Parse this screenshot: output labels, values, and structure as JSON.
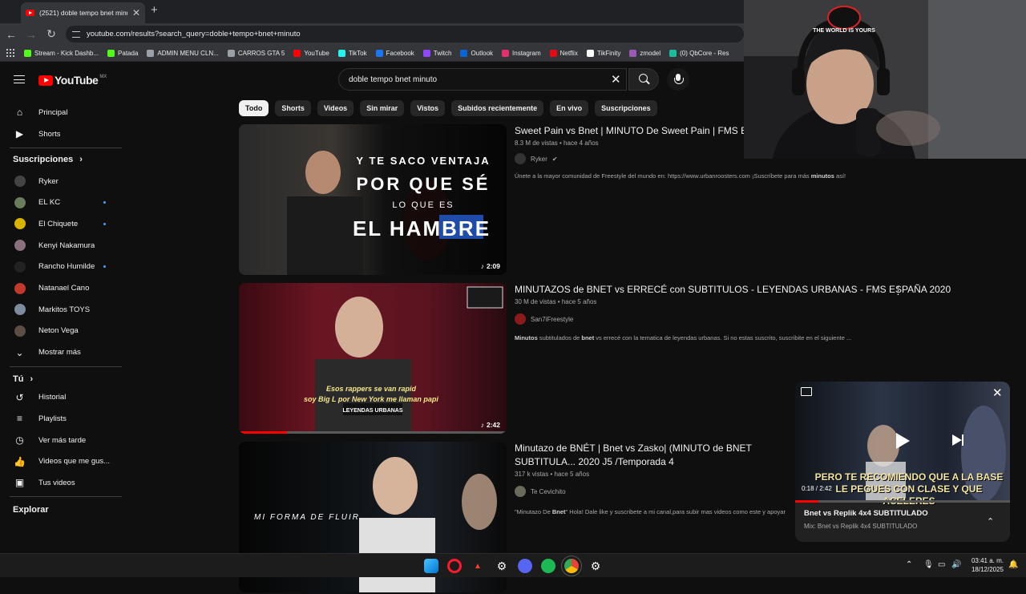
{
  "browser": {
    "tab_title": "(2521) doble tempo bnet minuto - YouTube",
    "url": "youtube.com/results?search_query=doble+tempo+bnet+minuto",
    "bookmarks": [
      {
        "label": "Stream - Kick Dashb...",
        "color": "#53fc18"
      },
      {
        "label": "Patada",
        "color": "#53fc18"
      },
      {
        "label": "ADMIN MENU CLN...",
        "color": "#9aa0a6"
      },
      {
        "label": "CARROS GTA 5",
        "color": "#9aa0a6"
      },
      {
        "label": "YouTube",
        "color": "#ff0000"
      },
      {
        "label": "TikTok",
        "color": "#25f4ee"
      },
      {
        "label": "Facebook",
        "color": "#1877f2"
      },
      {
        "label": "Twitch",
        "color": "#9146ff"
      },
      {
        "label": "Outlook",
        "color": "#0a64d6"
      },
      {
        "label": "Instagram",
        "color": "#e1306c"
      },
      {
        "label": "Netflix",
        "color": "#e50914"
      },
      {
        "label": "TikFinity",
        "color": "#ffffff"
      },
      {
        "label": "zmodel",
        "color": "#9b59b6"
      },
      {
        "label": "(0) QbCore - Res",
        "color": "#1abc9c"
      }
    ]
  },
  "youtube": {
    "logo_text": "YouTube",
    "country_code": "MX",
    "search_value": "doble tempo bnet minuto",
    "sidebar": {
      "main": [
        {
          "label": "Principal",
          "icon": "home-icon"
        },
        {
          "label": "Shorts",
          "icon": "shorts-icon"
        }
      ],
      "subs_heading": "Suscripciones",
      "subscriptions": [
        {
          "label": "Ryker",
          "color": "#444",
          "dot": false
        },
        {
          "label": "EL KC",
          "color": "#6a7d5a",
          "dot": true
        },
        {
          "label": "El Chiquete",
          "color": "#d9b300",
          "dot": true
        },
        {
          "label": "Kenyi Nakamura",
          "color": "#8a6f7e",
          "dot": false
        },
        {
          "label": "Rancho Humilde",
          "color": "#222",
          "dot": true
        },
        {
          "label": "Natanael Cano",
          "color": "#c0392b",
          "dot": false
        },
        {
          "label": "Markitos TOYS",
          "color": "#7f8c9d",
          "dot": false
        },
        {
          "label": "Neton Vega",
          "color": "#5d4e45",
          "dot": false
        }
      ],
      "show_more": "Mostrar más",
      "you_heading": "Tú",
      "you_items": [
        {
          "label": "Historial",
          "icon": "history-icon"
        },
        {
          "label": "Playlists",
          "icon": "playlist-icon"
        },
        {
          "label": "Ver más tarde",
          "icon": "clock-icon"
        },
        {
          "label": "Videos que me gus...",
          "icon": "thumbs-up-icon"
        },
        {
          "label": "Tus videos",
          "icon": "video-icon"
        }
      ],
      "explore_heading": "Explorar"
    },
    "chips": [
      "Todo",
      "Shorts",
      "Videos",
      "Sin mirar",
      "Vistos",
      "Subidos recientemente",
      "En vivo",
      "Suscripciones"
    ],
    "videos": [
      {
        "title": "Sweet Pain vs Bnet | MINUTO De Sweet Pain | FMS Es... Recuperativa | Ryker",
        "meta": "8.3 M de vistas • hace 4 años",
        "channel": "Ryker",
        "desc_pre": "Únete a la mayor comunidad de Freestyle del mundo en: https://www.urbanroosters.com ¡Suscríbete para más ",
        "desc_bold": "minutos",
        "desc_post": " así!",
        "duration": "2:09",
        "thumb_lines": [
          "Y TE SACO VENTAJA",
          "POR QUE SÉ",
          "LO QUE ES",
          "EL HAMBRE"
        ],
        "progress": 0
      },
      {
        "title": "MINUTAZOS de BNET vs ERRECÉ con SUBTITULOS - LEYENDAS URBANAS - FMS ESPAÑA 2020",
        "meta": "30 M de vistas • hace 5 años",
        "channel": "San7iFreestyle",
        "desc_bold": "Minutos",
        "desc_mid": " subtitulados de ",
        "desc_bold2": "bnet",
        "desc_post": " vs errecé con la tematica de leyendas urbanas. Si no estas suscrito, suscribite en el siguiente ...",
        "duration": "2:42",
        "thumb_lines": [
          "Esos rappers se van rapid",
          "soy Big L por New York me llaman papi",
          "LEYENDAS URBANAS"
        ],
        "progress": 0.18
      },
      {
        "title": "Minutazo de BNÉT | Bnet vs Zasko| (MINUTO de BNET SUBTITULA... 2020 J5 /Temporada 4",
        "meta": "317 k vistas • hace 5 años",
        "channel": "Te Cevichito",
        "desc_pre": "\"Minutazo De ",
        "desc_bold": "Bnet",
        "desc_post": "\" Hola! Dale like y suscribete a mi canal,para subir mas videos como este y apoyar",
        "thumb_lines": [
          "MI FORMA DE FLUIR"
        ],
        "progress": 0
      }
    ],
    "miniplayer": {
      "subtitle": "PERO TE RECOMIENDO QUE A LA BASE LE PEGUES CON CLASE Y QUE ACELERES",
      "time": "0:18 / 2:42",
      "progress": 0.11,
      "title": "Bnet vs Replik 4x4 SUBTITULADO",
      "subtitle2": "Mix: Bnet vs Replik 4x4 SUBTITULADO"
    }
  },
  "webcam": {
    "cap_text": "THE WORLD IS YOURS"
  },
  "taskbar": {
    "time": "03:41 a. m.",
    "date": "18/12/2025"
  }
}
